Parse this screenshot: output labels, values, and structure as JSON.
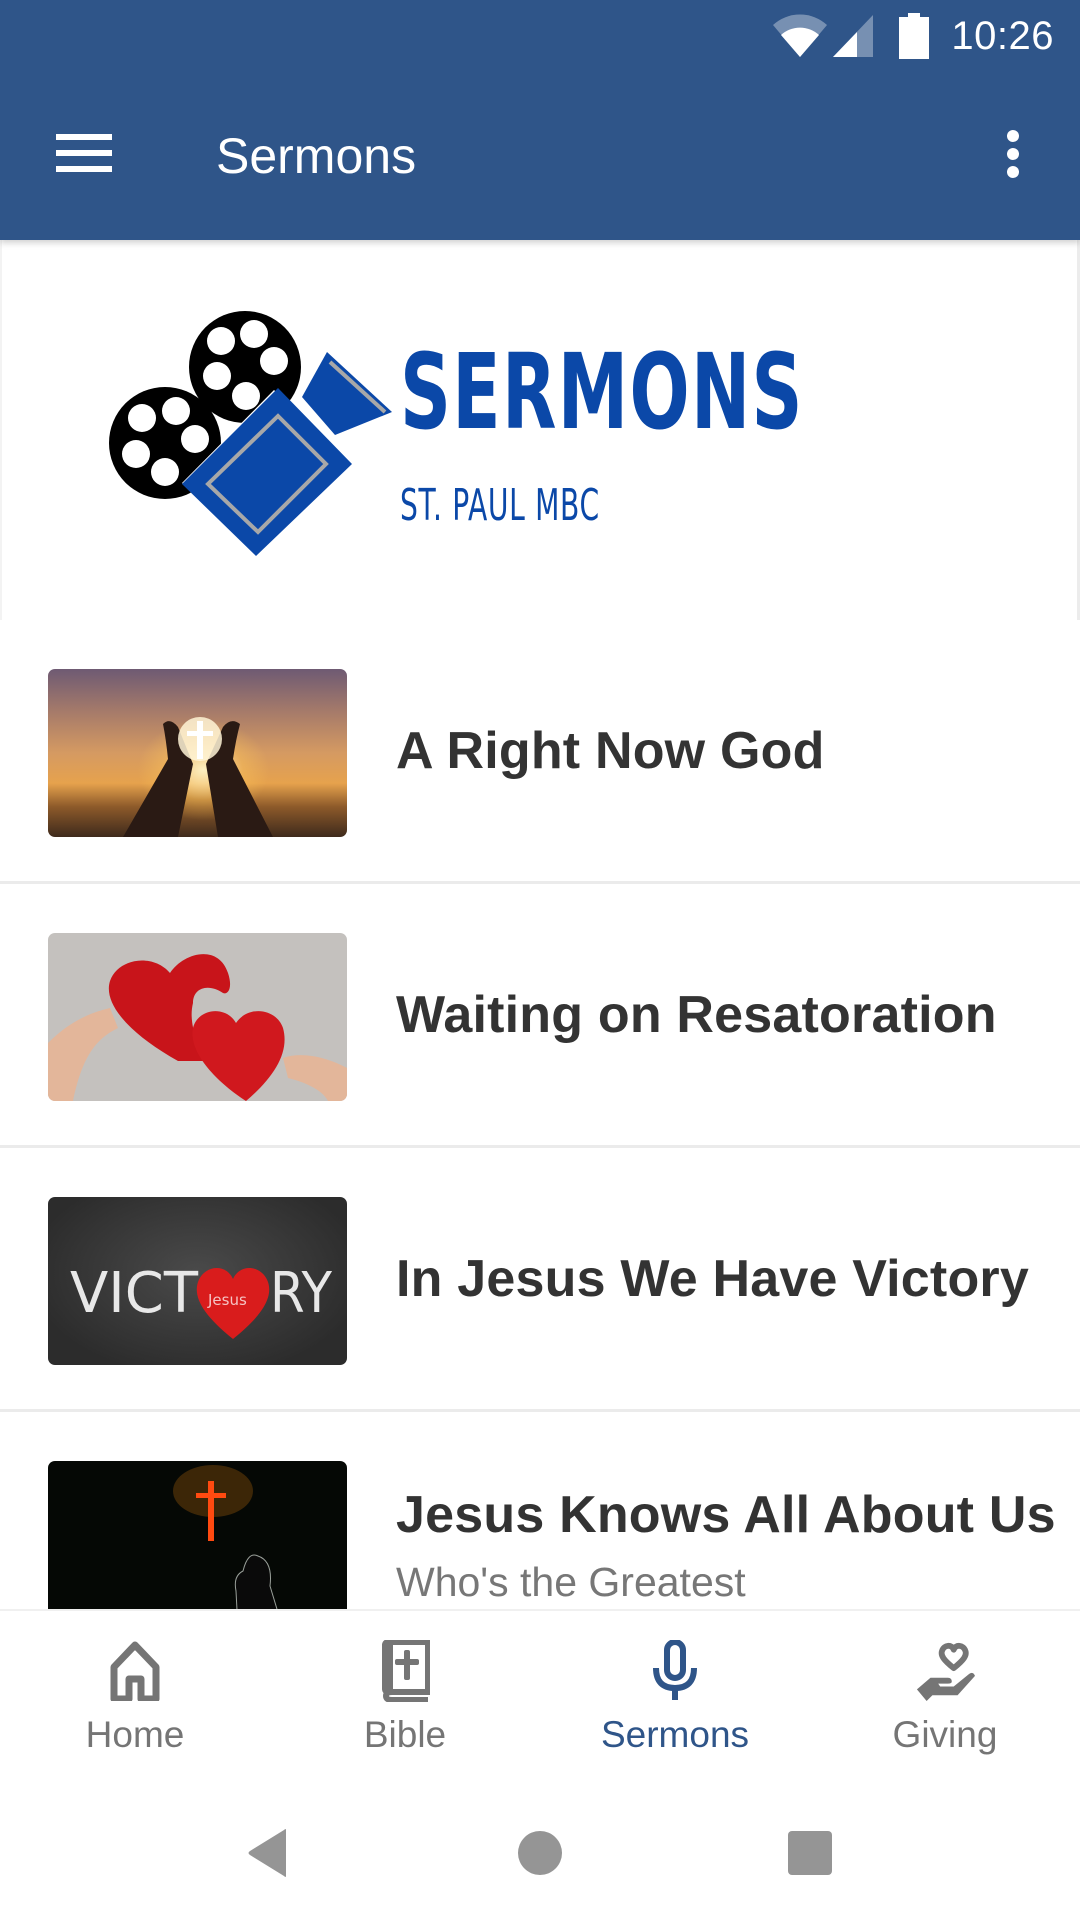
{
  "status_bar": {
    "time": "10:26",
    "icons": [
      "wifi-icon",
      "cellular-signal-icon",
      "battery-icon"
    ]
  },
  "toolbar": {
    "menu_icon": "hamburger-menu-icon",
    "title": "Sermons",
    "more_icon": "more-vert-icon"
  },
  "banner": {
    "title": "SERMONS",
    "subtitle": "ST. PAUL MBC",
    "logo_icon": "film-camera-icon",
    "brand_color": "#0b48a8"
  },
  "sermons": [
    {
      "title": "A Right Now God",
      "subtitle": null,
      "thumbnail": "praying-hands-sunset-cross-image"
    },
    {
      "title": "Waiting on Resatoration",
      "subtitle": null,
      "thumbnail": "red-hearts-image"
    },
    {
      "title": "In Jesus We Have Victory",
      "subtitle": null,
      "thumbnail": "victory-chalkboard-image",
      "thumbnail_text": {
        "word_left": "VICT",
        "word_right": "RY",
        "heart_text": "Jesus"
      }
    },
    {
      "title": "Jesus Knows All About Us",
      "subtitle": "Who's the Greatest",
      "thumbnail": "cross-silhouette-image"
    }
  ],
  "bottom_nav": {
    "items": [
      {
        "label": "Home",
        "icon": "home-icon",
        "active": false
      },
      {
        "label": "Bible",
        "icon": "bible-icon",
        "active": false
      },
      {
        "label": "Sermons",
        "icon": "microphone-icon",
        "active": true
      },
      {
        "label": "Giving",
        "icon": "giving-hand-heart-icon",
        "active": false
      }
    ],
    "active_color": "#2f5589",
    "inactive_color": "#757575"
  },
  "system_nav": {
    "buttons": [
      "back-icon",
      "home-circle-icon",
      "recents-icon"
    ]
  },
  "colors": {
    "primary": "#2f5589",
    "text_primary": "#333333",
    "text_secondary": "#777777"
  }
}
